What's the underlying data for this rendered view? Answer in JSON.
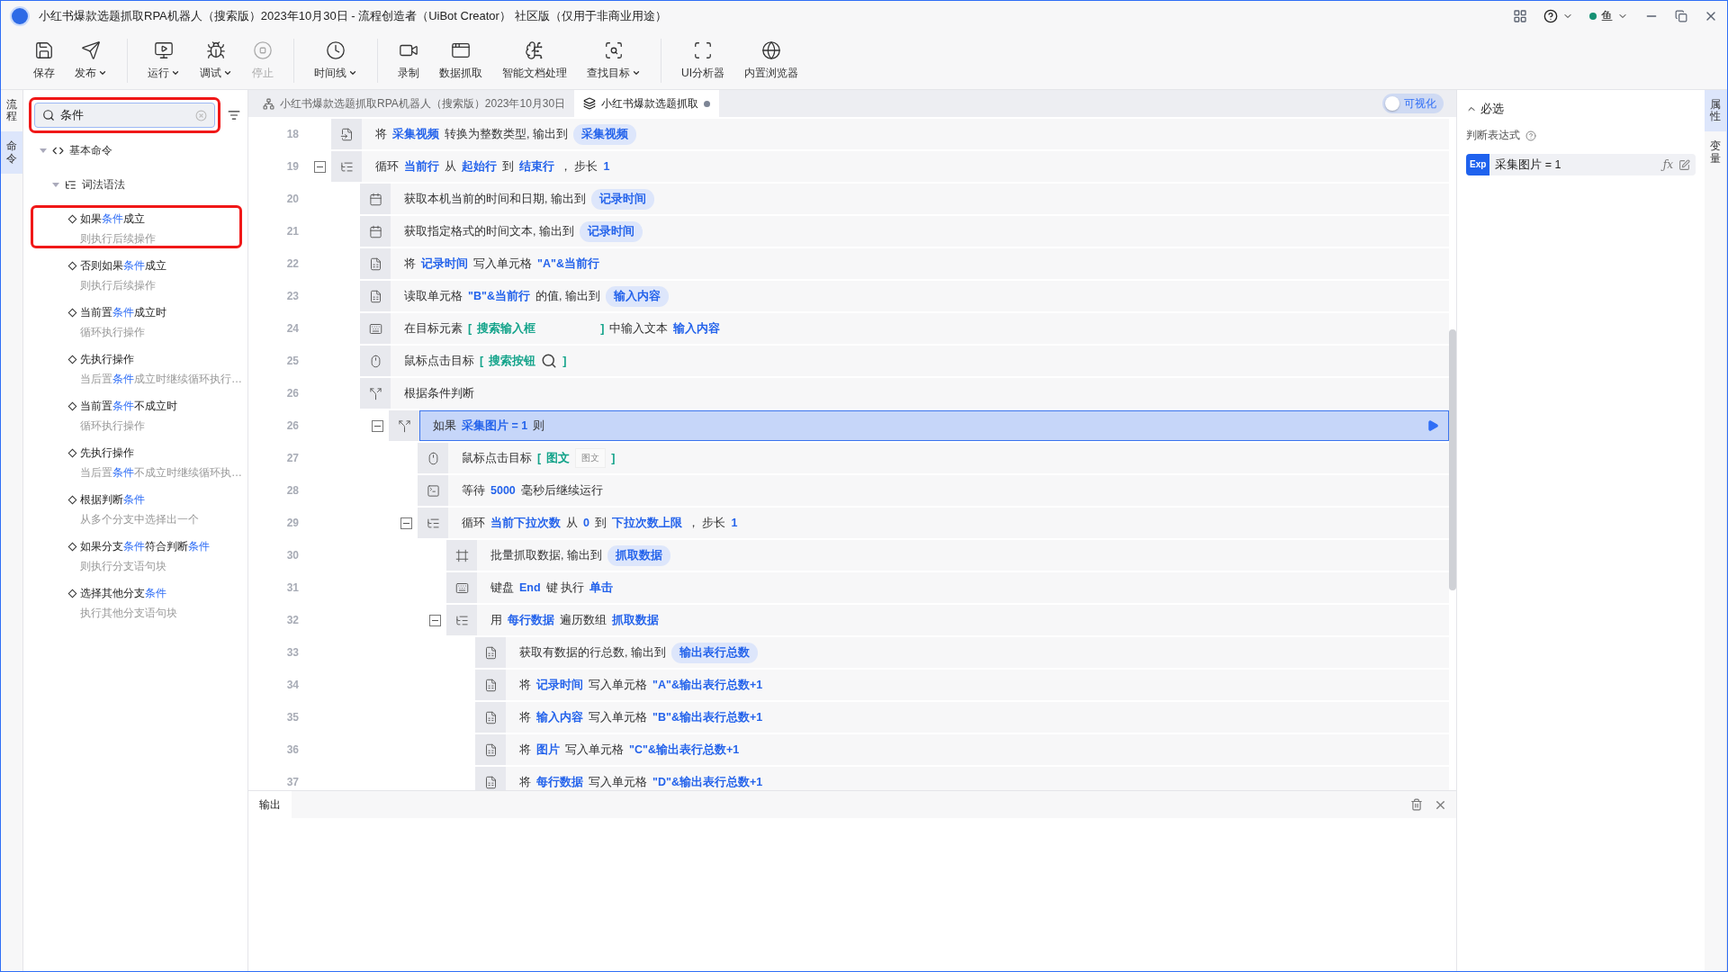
{
  "window": {
    "title": "小红书爆款选题抓取RPA机器人（搜索版）2023年10月30日 - 流程创造者（UiBot Creator） 社区版（仅用于非商业用途）",
    "user": "鱼"
  },
  "toolbar": [
    {
      "buttons": [
        {
          "label": "保存",
          "dropdown": false,
          "disabled": false
        },
        {
          "label": "发布",
          "dropdown": true,
          "disabled": false
        }
      ]
    },
    {
      "buttons": [
        {
          "label": "运行",
          "dropdown": true,
          "disabled": false
        },
        {
          "label": "调试",
          "dropdown": true,
          "disabled": false
        },
        {
          "label": "停止",
          "dropdown": false,
          "disabled": true
        }
      ]
    },
    {
      "buttons": [
        {
          "label": "时间线",
          "dropdown": true,
          "disabled": false
        }
      ]
    },
    {
      "buttons": [
        {
          "label": "录制",
          "dropdown": false,
          "disabled": false
        },
        {
          "label": "数据抓取",
          "dropdown": false,
          "disabled": false
        },
        {
          "label": "智能文档处理",
          "dropdown": false,
          "disabled": false
        },
        {
          "label": "查找目标",
          "dropdown": true,
          "disabled": false
        }
      ]
    },
    {
      "buttons": [
        {
          "label": "UI分析器",
          "dropdown": false,
          "disabled": false
        },
        {
          "label": "内置浏览器",
          "dropdown": false,
          "disabled": false
        }
      ]
    }
  ],
  "left_rail": [
    {
      "label": "流程",
      "selected": false
    },
    {
      "label": "命令",
      "selected": true
    }
  ],
  "search": {
    "value": "条件",
    "annotated": true
  },
  "command_tree": [
    {
      "label": "基本命令",
      "expanded": true,
      "children": [
        {
          "label": "词法语法",
          "expanded": true,
          "children": [
            {
              "title": "如果**条件**成立",
              "description": "则执行后续操作",
              "annotated": true
            },
            {
              "title": "否则如果**条件**成立",
              "description": "则执行后续操作",
              "annotated": false
            },
            {
              "title": "当前置**条件**成立时",
              "description": "循环执行操作",
              "annotated": false
            },
            {
              "title": "先执行操作",
              "description": "当后置**条件**成立时继续循环执行…",
              "annotated": false
            },
            {
              "title": "当前置**条件**不成立时",
              "description": "循环执行操作",
              "annotated": false
            },
            {
              "title": "先执行操作",
              "description": "当后置**条件**不成立时继续循环执…",
              "annotated": false
            },
            {
              "title": "根据判断**条件**",
              "description": "从多个分支中选择出一个",
              "annotated": false
            },
            {
              "title": "如果分支**条件**符合判断**条件**",
              "description": "则执行分支语句块",
              "annotated": false
            },
            {
              "title": "选择其他分支**条件**",
              "description": "执行其他分支语句块",
              "annotated": false
            }
          ]
        }
      ]
    }
  ],
  "tabs": [
    {
      "label": "小红书爆款选题抓取RPA机器人（搜索版）2023年10月30日",
      "selected": false,
      "kind": "project",
      "modified": false
    },
    {
      "label": "小红书爆款选题抓取",
      "selected": true,
      "kind": "flow",
      "modified": true
    }
  ],
  "visual_toggle": {
    "label": "可视化",
    "on": false
  },
  "lines": [
    {
      "number": "18",
      "kind": "convert",
      "selected": false,
      "segments": [
        {
          "kind": "plain",
          "text": "将"
        },
        {
          "kind": "var",
          "text": "采集视频"
        },
        {
          "kind": "plain",
          "text": "转换为整数类型, 输出到"
        },
        {
          "kind": "pill",
          "text": "采集视频"
        }
      ]
    },
    {
      "number": "19",
      "kind": "loop",
      "expanded": true,
      "selected": false,
      "segments": [
        {
          "kind": "plain",
          "text": "循环"
        },
        {
          "kind": "var",
          "text": "当前行"
        },
        {
          "kind": "plain",
          "text": "从"
        },
        {
          "kind": "var",
          "text": "起始行"
        },
        {
          "kind": "plain",
          "text": "到"
        },
        {
          "kind": "var",
          "text": "结束行"
        },
        {
          "kind": "plain",
          "text": "，  步长"
        },
        {
          "kind": "var",
          "text": "1"
        }
      ],
      "children": [
        {
          "number": "20",
          "kind": "calendar",
          "selected": false,
          "segments": [
            {
              "kind": "plain",
              "text": "获取本机当前的时间和日期, 输出到"
            },
            {
              "kind": "pill",
              "text": "记录时间"
            }
          ]
        },
        {
          "number": "21",
          "kind": "calendar",
          "selected": false,
          "segments": [
            {
              "kind": "plain",
              "text": "获取指定格式的时间文本, 输出到"
            },
            {
              "kind": "pill",
              "text": "记录时间"
            }
          ]
        },
        {
          "number": "22",
          "kind": "excel",
          "selected": false,
          "segments": [
            {
              "kind": "plain",
              "text": "将"
            },
            {
              "kind": "var",
              "text": "记录时间"
            },
            {
              "kind": "plain",
              "text": "写入单元格"
            },
            {
              "kind": "var",
              "text": "\"A\"&当前行"
            }
          ]
        },
        {
          "number": "23",
          "kind": "excel",
          "selected": false,
          "segments": [
            {
              "kind": "plain",
              "text": "读取单元格"
            },
            {
              "kind": "var",
              "text": "\"B\"&当前行"
            },
            {
              "kind": "plain",
              "text": "的值, 输出到"
            },
            {
              "kind": "pill",
              "text": "输入内容"
            }
          ]
        },
        {
          "number": "24",
          "kind": "keyboard",
          "selected": false,
          "segments": [
            {
              "kind": "plain",
              "text": "在目标元素"
            },
            {
              "kind": "element",
              "text": "["
            },
            {
              "kind": "element",
              "text": "搜索输入框"
            },
            {
              "kind": "blank_thumb"
            },
            {
              "kind": "element",
              "text": "]"
            },
            {
              "kind": "plain",
              "text": "中输入文本"
            },
            {
              "kind": "var",
              "text": "输入内容"
            }
          ]
        },
        {
          "number": "25",
          "kind": "mouse",
          "selected": false,
          "segments": [
            {
              "kind": "plain",
              "text": "鼠标点击目标"
            },
            {
              "kind": "element",
              "text": "["
            },
            {
              "kind": "element",
              "text": "搜索按钮"
            },
            {
              "kind": "search_thumb"
            },
            {
              "kind": "element",
              "text": "]"
            }
          ]
        },
        {
          "number": "26",
          "kind": "branch",
          "selected": false,
          "segments": [
            {
              "kind": "plain",
              "text": "根据条件判断"
            }
          ],
          "children": [
            {
              "number": "26",
              "kind": "branch",
              "expanded": true,
              "selected": true,
              "segments": [
                {
                  "kind": "plain",
                  "text": "如果"
                },
                {
                  "kind": "var",
                  "text": "采集图片 = 1"
                },
                {
                  "kind": "plain",
                  "text": "则"
                }
              ],
              "children": [
                {
                  "number": "27",
                  "kind": "mouse",
                  "selected": false,
                  "segments": [
                    {
                      "kind": "plain",
                      "text": "鼠标点击目标"
                    },
                    {
                      "kind": "element",
                      "text": "["
                    },
                    {
                      "kind": "element",
                      "text": "图文"
                    },
                    {
                      "kind": "text_thumb",
                      "text": "图文"
                    },
                    {
                      "kind": "element",
                      "text": "]"
                    }
                  ]
                },
                {
                  "number": "28",
                  "kind": "wait",
                  "selected": false,
                  "segments": [
                    {
                      "kind": "plain",
                      "text": "等待"
                    },
                    {
                      "kind": "var",
                      "text": "5000"
                    },
                    {
                      "kind": "plain",
                      "text": "毫秒后继续运行"
                    }
                  ]
                },
                {
                  "number": "29",
                  "kind": "loop",
                  "expanded": true,
                  "selected": false,
                  "segments": [
                    {
                      "kind": "plain",
                      "text": "循环"
                    },
                    {
                      "kind": "var",
                      "text": "当前下拉次数"
                    },
                    {
                      "kind": "plain",
                      "text": "从"
                    },
                    {
                      "kind": "var",
                      "text": "0"
                    },
                    {
                      "kind": "plain",
                      "text": "到"
                    },
                    {
                      "kind": "var",
                      "text": "下拉次数上限"
                    },
                    {
                      "kind": "plain",
                      "text": "，  步长"
                    },
                    {
                      "kind": "var",
                      "text": "1"
                    }
                  ],
                  "children": [
                    {
                      "number": "30",
                      "kind": "batch",
                      "selected": false,
                      "segments": [
                        {
                          "kind": "plain",
                          "text": "批量抓取数据, 输出到"
                        },
                        {
                          "kind": "pill",
                          "text": "抓取数据"
                        }
                      ]
                    },
                    {
                      "number": "31",
                      "kind": "keyboard",
                      "selected": false,
                      "segments": [
                        {
                          "kind": "plain",
                          "text": "键盘"
                        },
                        {
                          "kind": "var",
                          "text": "End"
                        },
                        {
                          "kind": "plain",
                          "text": "键 执行"
                        },
                        {
                          "kind": "var",
                          "text": "单击"
                        }
                      ]
                    },
                    {
                      "number": "32",
                      "kind": "loop",
                      "expanded": true,
                      "selected": false,
                      "segments": [
                        {
                          "kind": "plain",
                          "text": "用"
                        },
                        {
                          "kind": "var",
                          "text": "每行数据"
                        },
                        {
                          "kind": "plain",
                          "text": "遍历数组"
                        },
                        {
                          "kind": "var",
                          "text": "抓取数据"
                        }
                      ],
                      "children": [
                        {
                          "number": "33",
                          "kind": "excel",
                          "selected": false,
                          "segments": [
                            {
                              "kind": "plain",
                              "text": "获取有数据的行总数, 输出到"
                            },
                            {
                              "kind": "pill",
                              "text": "输出表行总数"
                            }
                          ]
                        },
                        {
                          "number": "34",
                          "kind": "excel",
                          "selected": false,
                          "segments": [
                            {
                              "kind": "plain",
                              "text": "将"
                            },
                            {
                              "kind": "var",
                              "text": "记录时间"
                            },
                            {
                              "kind": "plain",
                              "text": "写入单元格"
                            },
                            {
                              "kind": "var",
                              "text": "\"A\"&输出表行总数+1"
                            }
                          ]
                        },
                        {
                          "number": "35",
                          "kind": "excel",
                          "selected": false,
                          "segments": [
                            {
                              "kind": "plain",
                              "text": "将"
                            },
                            {
                              "kind": "var",
                              "text": "输入内容"
                            },
                            {
                              "kind": "plain",
                              "text": "写入单元格"
                            },
                            {
                              "kind": "var",
                              "text": "\"B\"&输出表行总数+1"
                            }
                          ]
                        },
                        {
                          "number": "36",
                          "kind": "excel",
                          "selected": false,
                          "segments": [
                            {
                              "kind": "plain",
                              "text": "将"
                            },
                            {
                              "kind": "var",
                              "text": "图片"
                            },
                            {
                              "kind": "plain",
                              "text": "写入单元格"
                            },
                            {
                              "kind": "var",
                              "text": "\"C\"&输出表行总数+1"
                            }
                          ]
                        },
                        {
                          "number": "37",
                          "kind": "excel",
                          "selected": false,
                          "segments": [
                            {
                              "kind": "plain",
                              "text": "将"
                            },
                            {
                              "kind": "var",
                              "text": "每行数据"
                            },
                            {
                              "kind": "plain",
                              "text": "写入单元格"
                            },
                            {
                              "kind": "var",
                              "text": "\"D\"&输出表行总数+1"
                            }
                          ]
                        }
                      ]
                    }
                  ]
                }
              ]
            }
          ]
        }
      ]
    }
  ],
  "output_panel": {
    "tab": "输出"
  },
  "properties": {
    "section": "必选",
    "expanded": true,
    "field_label": "判断表达式",
    "badge": "Exp",
    "expression": "采集图片 = 1",
    "function_button": "ƒx"
  },
  "right_rail": [
    {
      "label": "属性",
      "selected": true
    },
    {
      "label": "变量",
      "selected": false
    }
  ]
}
